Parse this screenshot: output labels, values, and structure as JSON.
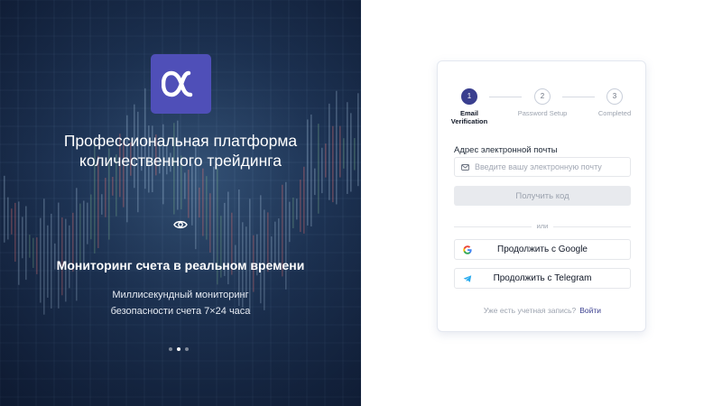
{
  "hero": {
    "logo_icon": "alpha-logo-icon",
    "title": "Профессиональная платформа количественного трейдинга",
    "feature_icon": "eye-icon",
    "feature_title": "Мониторинг счета в реальном времени",
    "feature_desc": "Миллисекундный мониторинг безопасности счета 7×24 часа",
    "slides_count": 3,
    "active_slide": 2
  },
  "steps": [
    {
      "number": "1",
      "label": "Email Verification",
      "active": true
    },
    {
      "number": "2",
      "label": "Password Setup",
      "active": false
    },
    {
      "number": "3",
      "label": "Completed",
      "active": false
    }
  ],
  "form": {
    "email_label": "Адрес электронной почты",
    "email_placeholder": "Введите вашу электронную почту",
    "email_value": "",
    "get_code_label": "Получить код",
    "divider_text": "или",
    "google_label": "Продолжить с Google",
    "telegram_label": "Продолжить с Telegram",
    "have_account_text": "Уже есть учетная запись?",
    "sign_in_link": "Войти"
  },
  "colors": {
    "accent": "#3a3f8f",
    "logo_bg": "#4f4fb8",
    "hero_bg": "#1f3658"
  }
}
